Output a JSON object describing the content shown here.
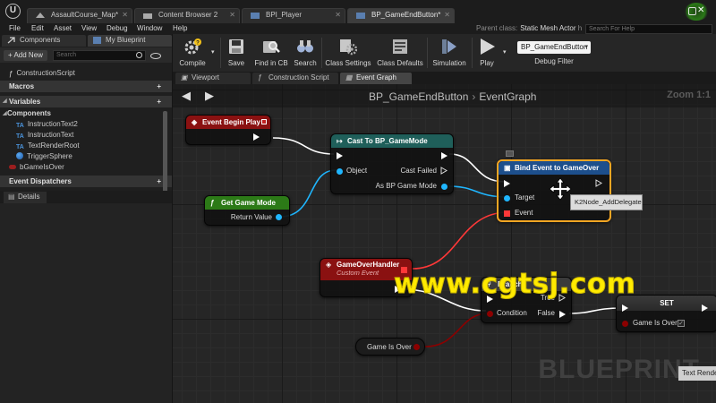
{
  "tabs": [
    {
      "label": "AssaultCourse_Map*"
    },
    {
      "label": "Content Browser 2"
    },
    {
      "label": "BPI_Player"
    },
    {
      "label": "BP_GameEndButton*"
    }
  ],
  "menu": {
    "items": [
      "File",
      "Edit",
      "Asset",
      "View",
      "Debug",
      "Window",
      "Help"
    ],
    "parent_class_label": "Parent class:",
    "parent_class_value": "Static Mesh Actor",
    "parent_class_suffix": "h",
    "help_search_placeholder": "Search For Help"
  },
  "left_panel": {
    "tab_components": "Components",
    "tab_my_blueprint": "My Blueprint",
    "add_new": "+ Add New",
    "search_placeholder": "Search",
    "construction_script": "ConstructionScript",
    "macros_label": "Macros",
    "variables_label": "Variables",
    "components_label": "Components",
    "components": [
      "InstructionText2",
      "InstructionText",
      "TextRenderRoot",
      "TriggerSphere"
    ],
    "variable_bool": "bGameIsOver",
    "event_dispatchers_label": "Event Dispatchers",
    "details_tab": "Details"
  },
  "toolbar": {
    "compile": "Compile",
    "save": "Save",
    "find_in_cb": "Find in CB",
    "search": "Search",
    "class_settings": "Class Settings",
    "class_defaults": "Class Defaults",
    "simulation": "Simulation",
    "play": "Play",
    "debug_select_value": "BP_GameEndButton",
    "debug_filter": "Debug Filter"
  },
  "editor_tabs": [
    {
      "label": "Viewport"
    },
    {
      "label": "Construction Script"
    },
    {
      "label": "Event Graph"
    }
  ],
  "graph": {
    "breadcrumb_root": "BP_GameEndButton",
    "breadcrumb_sep": "›",
    "breadcrumb_current": "EventGraph",
    "zoom": "Zoom 1:1",
    "watermark": "BLUEPRINT",
    "tooltip": "K2Node_AddDelegate",
    "overlay_text": "www.cgtsj.com",
    "textrender_tab": "Text Rende"
  },
  "nodes": {
    "event_begin_play": {
      "title": "Event Begin Play"
    },
    "cast": {
      "title": "Cast To BP_GameMode",
      "pin_object": "Object",
      "pin_cast_failed": "Cast Failed",
      "pin_as": "As BP Game Mode"
    },
    "get_game_mode": {
      "title": "Get Game Mode",
      "pin_return": "Return Value"
    },
    "bind_event": {
      "title": "Bind Event to GameOver",
      "pin_target": "Target",
      "pin_event": "Event"
    },
    "game_over_handler": {
      "title": "GameOverHandler",
      "subtitle": "Custom Event"
    },
    "branch": {
      "title": "Branch",
      "pin_true": "True",
      "pin_condition": "Condition",
      "pin_false": "False"
    },
    "set": {
      "title": "SET",
      "pin_game_is_over": "Game Is Over"
    },
    "game_is_over_get": {
      "label": "Game Is Over"
    }
  },
  "colors": {
    "event_header": "#8a1111",
    "cast_header": "#1f5f5a",
    "func_header": "#2c7a17",
    "bind_header": "#1d4f8c",
    "set_header": "#3a3a3a",
    "object_pin": "#1fb6ff",
    "bool_pin": "#8b0000",
    "delegate_pin": "#ff3838",
    "selection": "#f5a623"
  }
}
